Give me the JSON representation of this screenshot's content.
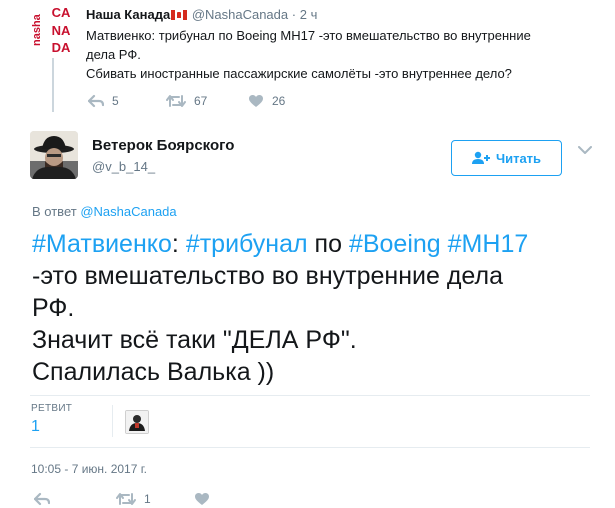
{
  "parent_tweet": {
    "avatar_logo": {
      "side_text": "nasha",
      "main_letters": [
        "CA",
        "NA",
        "DA"
      ],
      "color": "#c8102e"
    },
    "display_name": "Наша Канада",
    "flag_icon": "canada-flag-icon",
    "handle": "@NashaCanada",
    "separator": "·",
    "time": "2 ч",
    "text_lines": [
      "Матвиенко: трибунал по Boeing MH17 -это вмешательство во внутренние",
      "дела РФ.",
      "Сбивать иностранные пассажирские самолёты -это внутреннее дело?"
    ],
    "actions": {
      "reply_count": "5",
      "retweet_count": "67",
      "like_count": "26"
    }
  },
  "main_tweet": {
    "display_name": "Ветерок Боярского",
    "handle": "@v_b_14_",
    "follow_button_label": "Читать",
    "reply_prefix": "В ответ",
    "reply_handle": "@NashaCanada",
    "text": {
      "line1": {
        "tag1": "#Матвиенко",
        "sep1": ": ",
        "tag2": "#трибунал",
        "sep2": " по ",
        "tag3": "#Boeing",
        "sep3": " ",
        "tag4": "#MH17"
      },
      "line2": "-это вмешательство во внутренние дела",
      "line3": "РФ.",
      "line4": "Значит всё таки \"ДЕЛА РФ\".",
      "line5": "Спалилась Валька ))"
    },
    "stats": {
      "retweets_label": "РЕТВИТ",
      "retweets_count": "1"
    },
    "timestamp": "10:05 - 7 июн. 2017 г.",
    "actions": {
      "retweet_count": "1"
    }
  },
  "colors": {
    "link": "#1da1f2",
    "text": "#14171a",
    "muted": "#657786",
    "divider": "#e6ecf0",
    "brand_red": "#c8102e"
  }
}
